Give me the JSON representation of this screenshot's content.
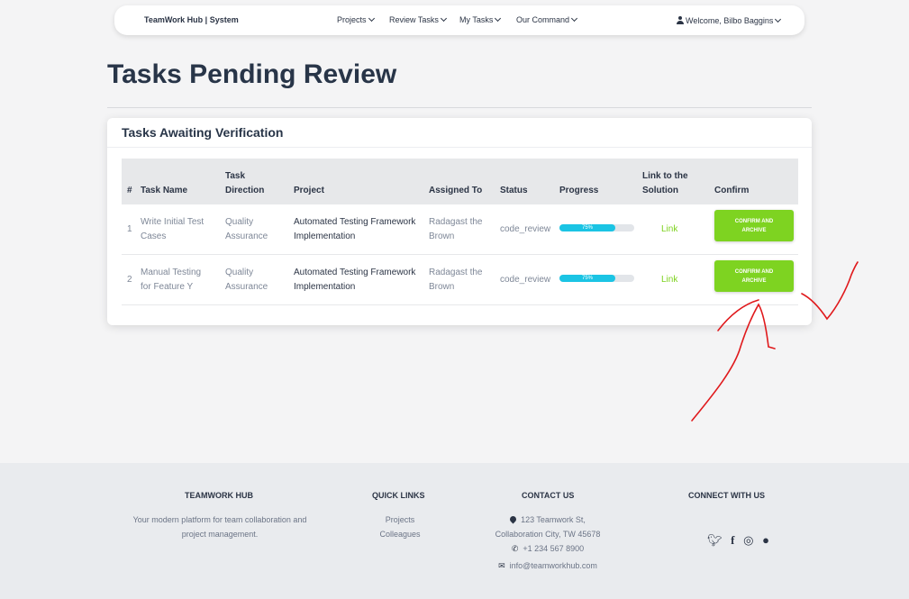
{
  "nav": {
    "brand": "TeamWork Hub | System",
    "items": [
      "Projects",
      "Review Tasks",
      "My Tasks",
      "Our Command"
    ],
    "user": "Welcome, Bilbo Baggins"
  },
  "page": {
    "title": "Tasks Pending Review"
  },
  "card": {
    "title": "Tasks Awaiting Verification",
    "headers": {
      "num": "#",
      "name": "Task Name",
      "direction_1": "Task",
      "direction_2": "Direction",
      "project": "Project",
      "assigned": "Assigned To",
      "status": "Status",
      "progress": "Progress",
      "link_1": "Link to the",
      "link_2": "Solution",
      "confirm": "Confirm"
    },
    "rows": [
      {
        "num": "1",
        "name_1": "Write Initial Test",
        "name_2": "Cases",
        "dir_1": "Quality",
        "dir_2": "Assurance",
        "proj_1": "Automated Testing Framework",
        "proj_2": "Implementation",
        "assigned_1": "Radagast the",
        "assigned_2": "Brown",
        "status": "code_review",
        "progress_label": "75%",
        "progress": 0.75,
        "link": "Link",
        "btn_1": "CONFIRM AND",
        "btn_2": "ARCHIVE"
      },
      {
        "num": "2",
        "name_1": "Manual Testing",
        "name_2": "for Feature Y",
        "dir_1": "Quality",
        "dir_2": "Assurance",
        "proj_1": "Automated Testing Framework",
        "proj_2": "Implementation",
        "assigned_1": "Radagast the",
        "assigned_2": "Brown",
        "status": "code_review",
        "progress_label": "75%",
        "progress": 0.75,
        "link": "Link",
        "btn_1": "CONFIRM AND",
        "btn_2": "ARCHIVE"
      }
    ]
  },
  "footer": {
    "about_title": "TEAMWORK HUB",
    "about_1": "Your modern platform for team collaboration and",
    "about_2": "project management.",
    "links_title": "QUICK LINKS",
    "link_projects": "Projects",
    "link_colleagues": "Colleagues",
    "contact_title": "CONTACT US",
    "address_1": "123 Teamwork St,",
    "address_2": "Collaboration City, TW 45678",
    "phone": "+1 234 567 8900",
    "email": "info@teamworkhub.com",
    "social_title": "CONNECT WITH US",
    "social_icons": [
      "twitter-icon",
      "facebook-icon",
      "instagram-icon",
      "github-icon"
    ]
  },
  "colors": {
    "accent_green": "#7ed321",
    "progress_blue": "#1bc4e4",
    "annotation_red": "#e0191c"
  }
}
